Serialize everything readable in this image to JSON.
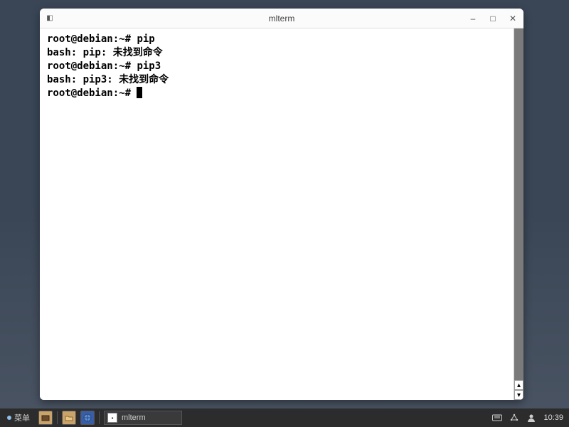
{
  "window": {
    "title": "mlterm"
  },
  "terminal": {
    "lines": [
      {
        "prompt": "root@debian:~#",
        "command": "pip"
      },
      {
        "output": "bash: pip: 未找到命令"
      },
      {
        "prompt": "root@debian:~#",
        "command": "pip3"
      },
      {
        "output": "bash: pip3: 未找到命令"
      },
      {
        "prompt": "root@debian:~#",
        "command": ""
      }
    ],
    "line1_prompt": "root@debian:~# ",
    "line1_cmd": "pip",
    "line2": "bash: pip: 未找到命令",
    "line3_prompt": "root@debian:~# ",
    "line3_cmd": "pip3",
    "line4": "bash: pip3: 未找到命令",
    "line5_prompt": "root@debian:~# "
  },
  "taskbar": {
    "menu_label": "菜单",
    "active_task": "mlterm",
    "clock": "10:39"
  }
}
